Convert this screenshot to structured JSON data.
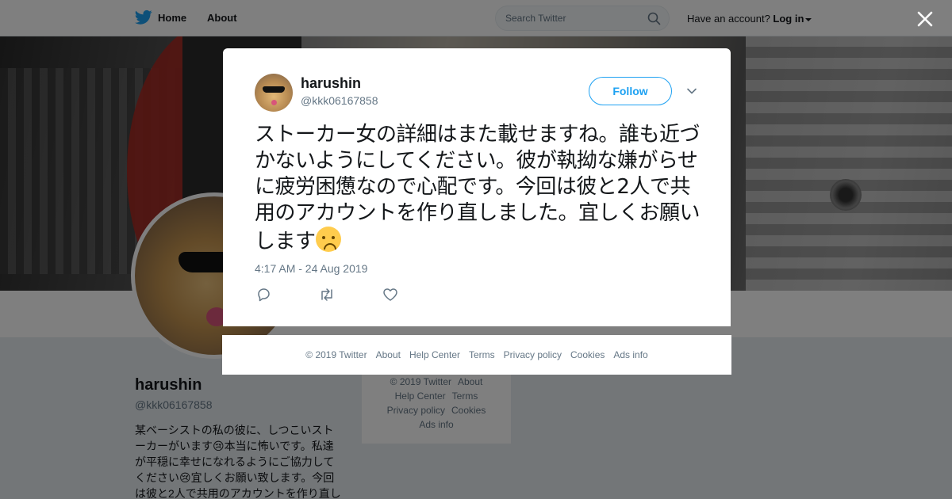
{
  "topbar": {
    "home_label": "Home",
    "about_label": "About",
    "search_placeholder": "Search Twitter",
    "account_text": "Have an account?",
    "login_label": "Log in"
  },
  "profile": {
    "name": "harushin",
    "handle": "@kkk06167858",
    "bio": "某ベーシストの私の彼に、しつこいストーカーがいます😢本当に怖いです。私達が平穏に幸せになれるようにご協力してください😢宜しくお願い致します。今回は彼と2人で共用のアカウントを作り直し"
  },
  "side_footer": {
    "items": [
      "© 2019 Twitter",
      "About",
      "Help Center",
      "Terms",
      "Privacy policy",
      "Cookies",
      "Ads info"
    ]
  },
  "tweet": {
    "name": "harushin",
    "handle": "@kkk06167858",
    "follow_label": "Follow",
    "text": "ストーカー女の詳細はまた載せますね。誰も近づかないようにしてください。彼が執拗な嫌がらせに疲労困憊なので心配です。今回は彼と2人で共用のアカウントを作り直しました。宜しくお願いします",
    "emoji": "crying-face",
    "timestamp": "4:17 AM - 24 Aug 2019"
  },
  "footer": {
    "items": [
      "© 2019 Twitter",
      "About",
      "Help Center",
      "Terms",
      "Privacy policy",
      "Cookies",
      "Ads info"
    ]
  },
  "colors": {
    "brand_blue": "#1da1f2",
    "text_primary": "#14171a",
    "text_secondary": "#657786"
  },
  "icons": {
    "logo": "twitter-bird-icon",
    "search": "search-icon",
    "close": "close-icon",
    "more": "chevron-down-icon",
    "reply": "reply-icon",
    "retweet": "retweet-icon",
    "like": "heart-icon"
  }
}
